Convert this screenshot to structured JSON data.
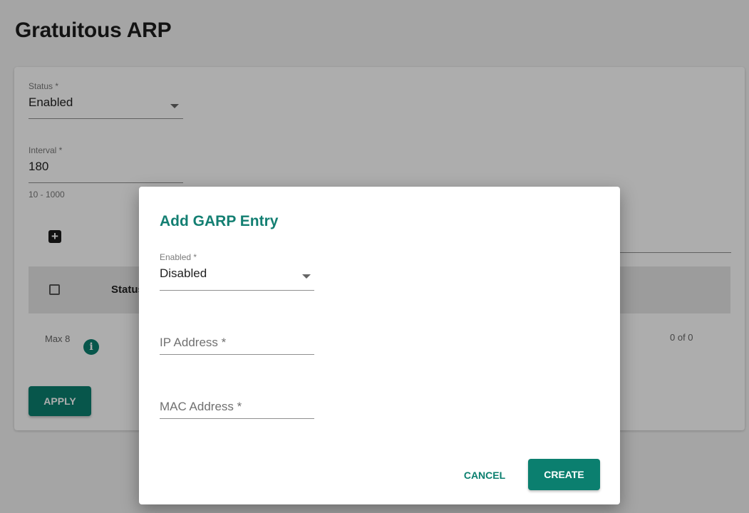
{
  "page": {
    "title": "Gratuitous ARP"
  },
  "settings": {
    "status": {
      "label": "Status *",
      "value": "Enabled"
    },
    "interval": {
      "label": "Interval *",
      "value": "180",
      "hint": "10 - 1000"
    }
  },
  "table": {
    "columns": [
      "Status"
    ],
    "max_label": "Max 8",
    "pagination": "0 of 0"
  },
  "actions": {
    "apply": "APPLY"
  },
  "dialog": {
    "title": "Add GARP Entry",
    "enabled": {
      "label": "Enabled *",
      "value": "Disabled"
    },
    "ip_address": {
      "placeholder": "IP Address *"
    },
    "mac_address": {
      "placeholder": "MAC Address *"
    },
    "cancel": "CANCEL",
    "create": "CREATE"
  },
  "icons": {
    "add": "plus-box-icon",
    "info": "info-icon",
    "dropdown": "caret-down-icon",
    "checkbox": "checkbox-icon"
  },
  "colors": {
    "accent": "#0b7f6f",
    "dialog_title": "#137f72"
  }
}
